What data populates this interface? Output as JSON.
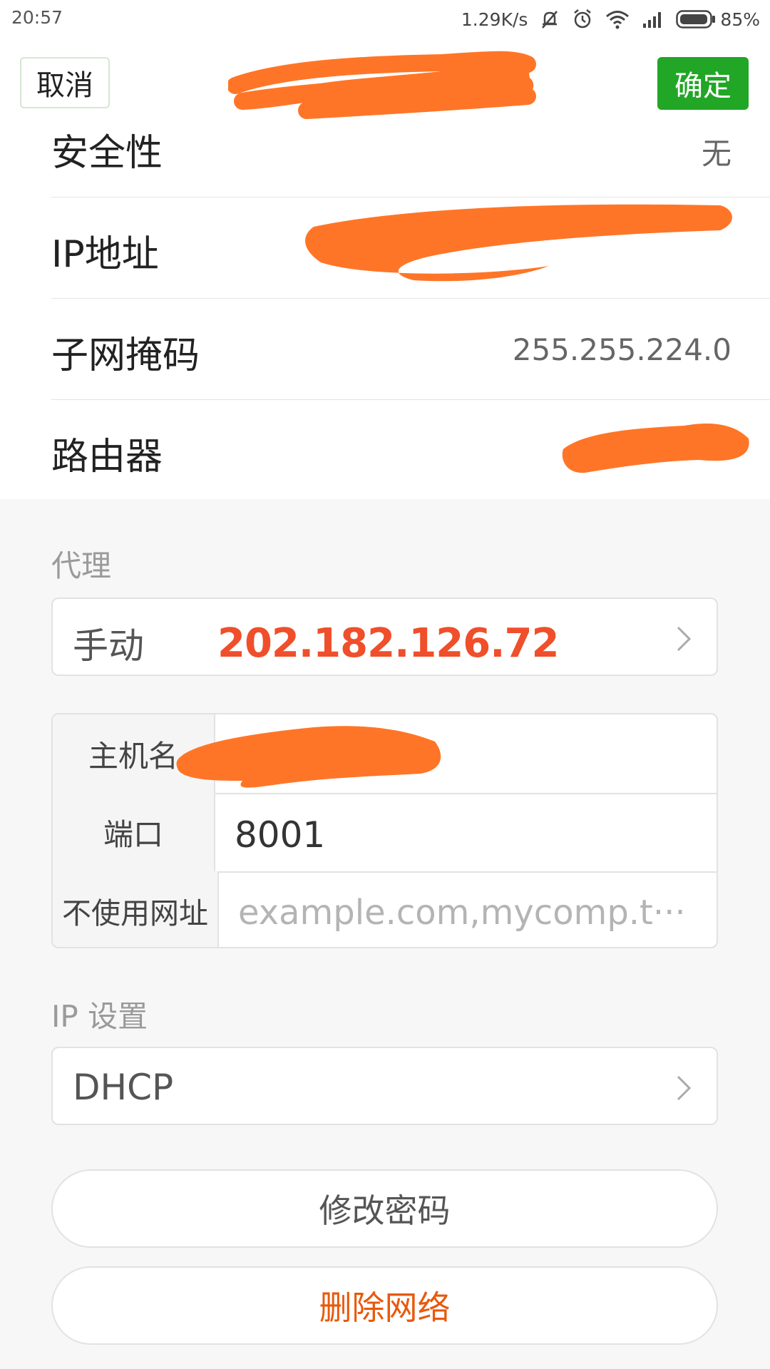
{
  "status_bar": {
    "time": "20:57",
    "net_speed": "1.29K/s",
    "battery": "85%",
    "icons": [
      "muted-bell-icon",
      "alarm-icon",
      "wifi-icon",
      "signal-icon",
      "battery-icon"
    ]
  },
  "header": {
    "cancel": "取消",
    "confirm": "确定",
    "confirm_color": "#21a626"
  },
  "info": {
    "security_label": "安全性",
    "security_value": "无",
    "ip_label": "IP地址",
    "subnet_label": "子网掩码",
    "subnet_value": "255.255.224.0",
    "router_label": "路由器"
  },
  "proxy": {
    "section_title": "代理",
    "mode": "手动",
    "overlay_ip": "202.182.126.72",
    "overlay_color": "#ef4f2a",
    "hostname_label": "主机名",
    "port_label": "端口",
    "port_value": "8001",
    "bypass_label": "不使用网址",
    "bypass_placeholder": "example.com,mycomp.t···"
  },
  "ip_settings": {
    "section_title": "IP 设置",
    "mode": "DHCP"
  },
  "actions": {
    "change_password": "修改密码",
    "delete_network": "删除网络",
    "delete_color": "#e8590c"
  },
  "redaction_color": "#ff7527"
}
